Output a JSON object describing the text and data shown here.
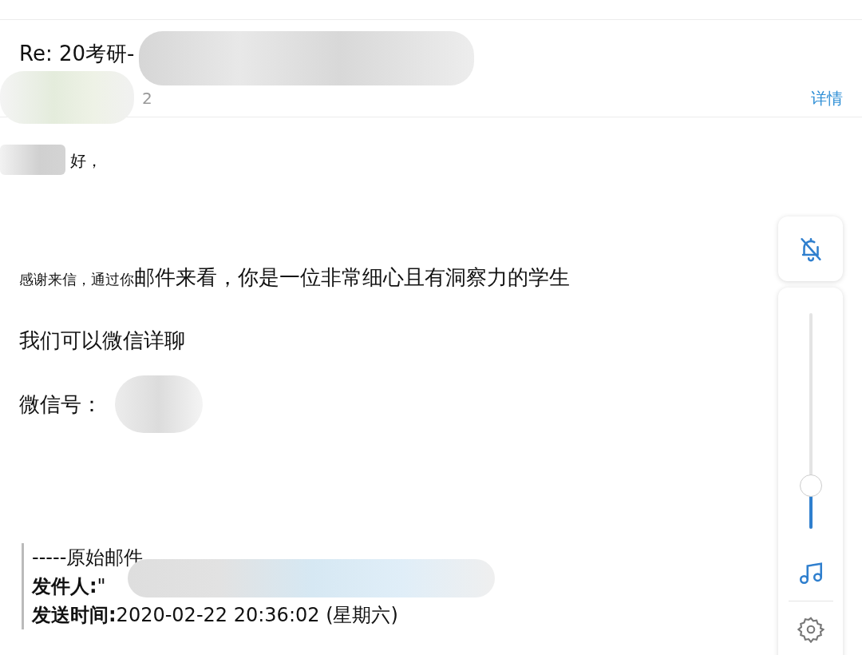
{
  "header": {
    "subject": "Re: 20考研-",
    "sender_fragment": "2",
    "details_link": "详情"
  },
  "body": {
    "greeting": "好，",
    "paragraphs": [
      {
        "kind": "mixed",
        "small": "感谢来信，通过你",
        "text": "邮件来看，你是一位非常细心且有洞察力的学生"
      },
      {
        "kind": "plain",
        "text": "我们可以微信详聊"
      },
      {
        "kind": "redacted",
        "text": "微信号："
      }
    ]
  },
  "quote": {
    "lines": [
      "-----原始邮件",
      "**发件人:**\"",
      "**发送时间:**2020-02-22 20:36:02 (星期六)"
    ]
  },
  "controls": {
    "ringer_muted": true,
    "volume": {
      "level": 0.2
    }
  }
}
